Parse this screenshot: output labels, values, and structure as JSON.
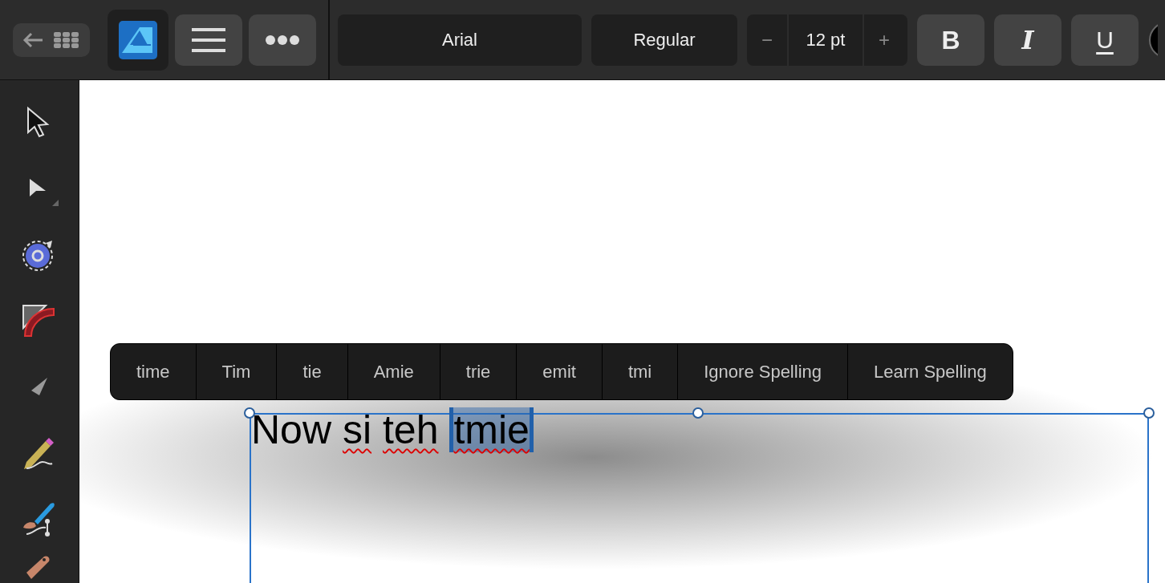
{
  "toolbar": {
    "font": "Arial",
    "style": "Regular",
    "size_minus": "−",
    "size": "12 pt",
    "size_plus": "+",
    "format_buttons": [
      {
        "kind": "bold",
        "label": "B"
      },
      {
        "kind": "italic",
        "label": "I"
      },
      {
        "kind": "underline",
        "label": "U"
      }
    ]
  },
  "tools": [
    {
      "kind": "move"
    },
    {
      "kind": "node"
    },
    {
      "kind": "contour"
    },
    {
      "kind": "corner"
    },
    {
      "kind": "pen"
    },
    {
      "kind": "pencil"
    },
    {
      "kind": "brush"
    },
    {
      "kind": "fill"
    }
  ],
  "spelling_menu": [
    {
      "label": "time"
    },
    {
      "label": "Tim"
    },
    {
      "label": "tie"
    },
    {
      "label": "Amie"
    },
    {
      "label": "trie"
    },
    {
      "label": "emit"
    },
    {
      "label": "tmi"
    },
    {
      "label": "Ignore Spelling"
    },
    {
      "label": "Learn Spelling"
    }
  ],
  "text_frame": {
    "words": [
      {
        "text": "Now",
        "misspelled": false,
        "selected": false
      },
      {
        "text": "si",
        "misspelled": true,
        "selected": false
      },
      {
        "text": "teh",
        "misspelled": true,
        "selected": false
      },
      {
        "text": "tmie",
        "misspelled": true,
        "selected": true
      }
    ]
  }
}
